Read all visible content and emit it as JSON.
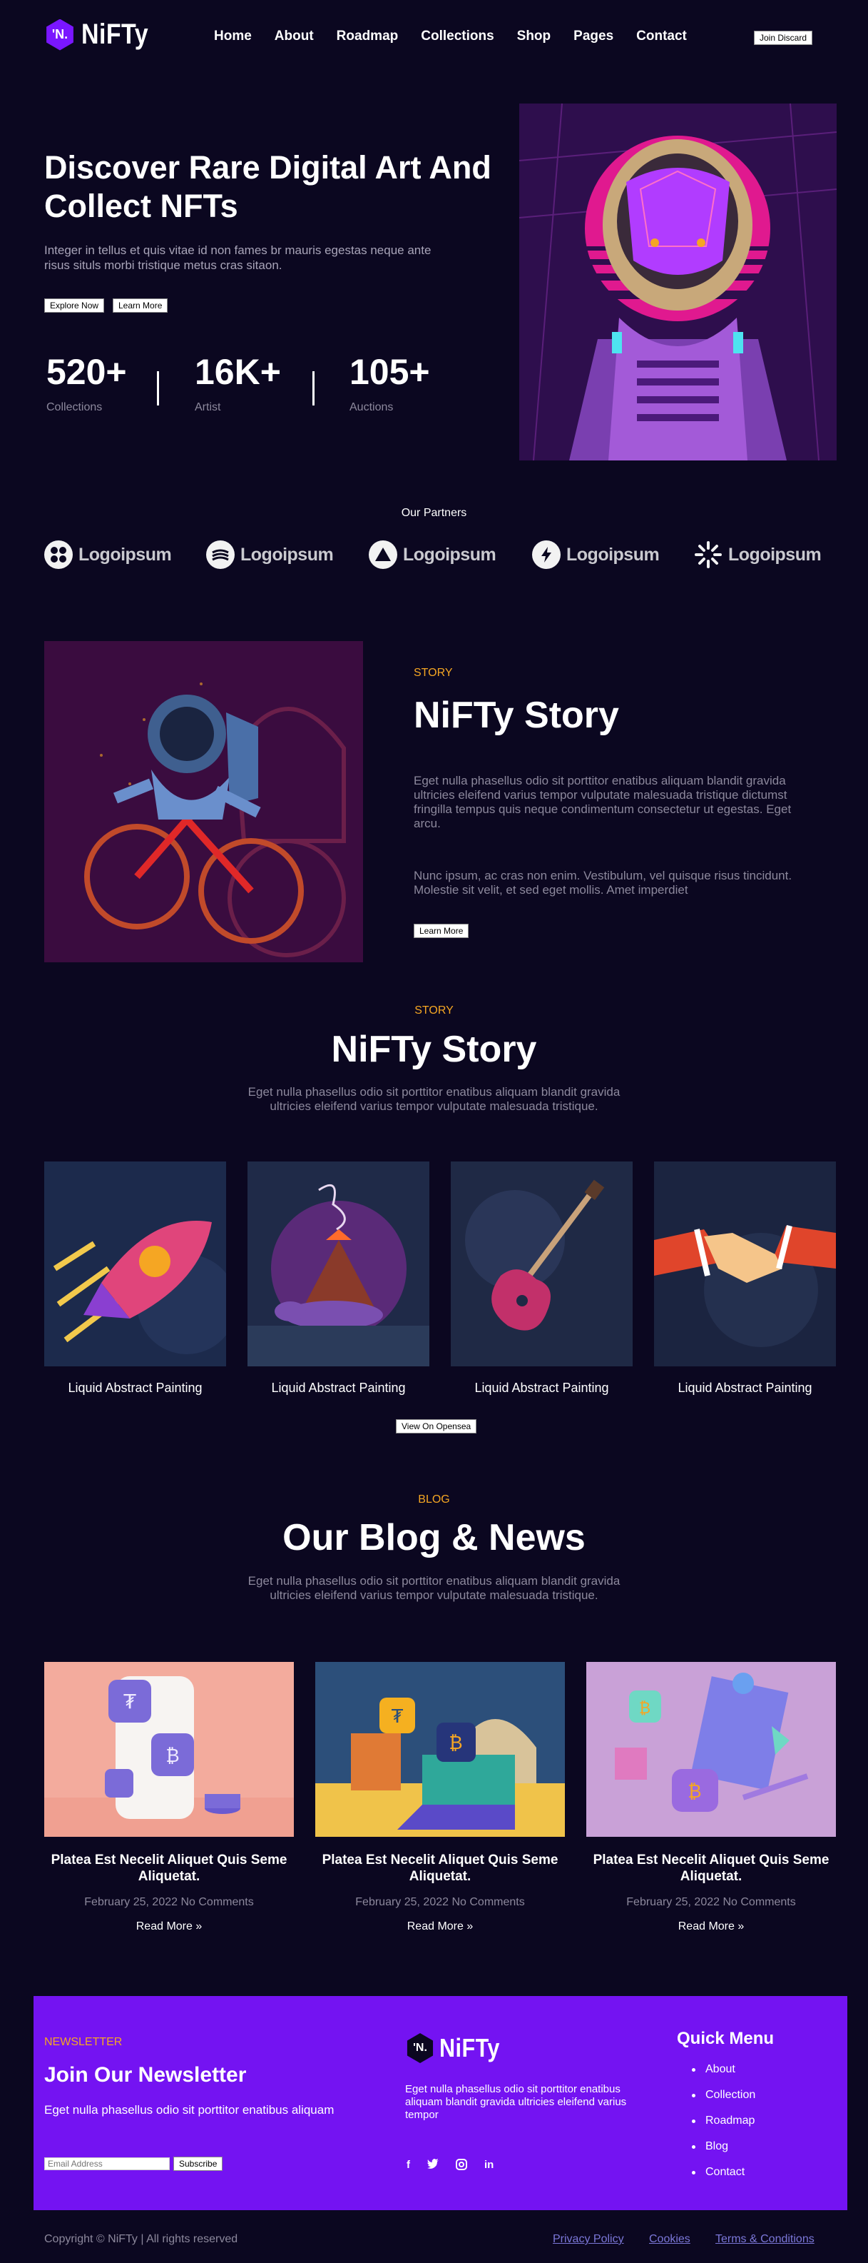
{
  "header": {
    "logo_badge": "'N.",
    "logo_text": "NiFTy",
    "nav": [
      "Home",
      "About",
      "Roadmap",
      "Collections",
      "Shop",
      "Pages",
      "Contact"
    ],
    "cta": "Join Discard"
  },
  "hero": {
    "title": "Discover Rare Digital Art And Collect NFTs",
    "subtitle": "Integer in tellus et quis vitae id non fames br mauris egestas neque ante risus situls morbi tristique metus cras sitaon.",
    "btn_explore": "Explore Now",
    "btn_learn": "Learn More",
    "stats": [
      {
        "value": "520+",
        "label": "Collections"
      },
      {
        "value": "16K+",
        "label": "Artist"
      },
      {
        "value": "105+",
        "label": "Auctions"
      }
    ]
  },
  "partners": {
    "title": "Our Partners",
    "items": [
      {
        "name": "Logoipsum",
        "icon": "grid-circles-icon"
      },
      {
        "name": "Logoipsum",
        "icon": "waves-circle-icon"
      },
      {
        "name": "Logoipsum",
        "icon": "triangle-circle-icon"
      },
      {
        "name": "Logoipsum",
        "icon": "bolt-circle-icon"
      },
      {
        "name": "Logoipsum",
        "icon": "sunburst-icon"
      }
    ]
  },
  "story": {
    "eyebrow": "STORY",
    "title": "NiFTy Story",
    "p1": "Eget nulla phasellus odio sit porttitor enatibus aliquam blandit gravida ultricies eleifend varius tempor vulputate malesuada tristique dictumst fringilla tempus quis neque condimentum consectetur ut egestas. Eget arcu.",
    "p2": "Nunc ipsum, ac cras non enim. Vestibulum, vel quisque risus tincidunt. Molestie sit velit, et sed eget mollis. Amet imperdiet",
    "btn": "Learn More"
  },
  "collection": {
    "eyebrow": "STORY",
    "title": "NiFTy Story",
    "text": "Eget nulla phasellus odio sit porttitor enatibus aliquam blandit gravida ultricies eleifend varius tempor vulputate malesuada tristique.",
    "items": [
      {
        "label": "Liquid Abstract Painting",
        "image": "rocket"
      },
      {
        "label": "Liquid Abstract Painting",
        "image": "volcano-dinosaur"
      },
      {
        "label": "Liquid Abstract Painting",
        "image": "guitar"
      },
      {
        "label": "Liquid Abstract Painting",
        "image": "handshake"
      }
    ],
    "btn": "View On Opensea"
  },
  "blog": {
    "eyebrow": "BLOG",
    "title": "Our Blog & News",
    "text": "Eget nulla phasellus odio sit porttitor enatibus aliquam blandit gravida ultricies eleifend varius tempor vulputate malesuada tristique.",
    "posts": [
      {
        "title": "Platea Est Necelit Aliquet Quis Seme Aliquetat.",
        "date": "February 25, 2022",
        "comments": "No Comments",
        "more": "Read More »"
      },
      {
        "title": "Platea Est Necelit Aliquet Quis Seme Aliquetat.",
        "date": "February 25, 2022",
        "comments": "No Comments",
        "more": "Read More »"
      },
      {
        "title": "Platea Est Necelit Aliquet Quis Seme Aliquetat.",
        "date": "February 25, 2022",
        "comments": "No Comments",
        "more": "Read More »"
      }
    ]
  },
  "newsletter": {
    "eyebrow": "NEWSLETTER",
    "title": "Join Our Newsletter",
    "text": "Eget nulla phasellus odio sit porttitor enatibus aliquam",
    "placeholder": "Email Address",
    "btn": "Subscribe",
    "brand_badge": "'N.",
    "brand_text": "NiFTy",
    "brand_desc": "Eget nulla phasellus odio sit porttitor enatibus aliquam blandit gravida ultricies eleifend varius tempor",
    "social": [
      "f",
      "t",
      "ig",
      "in"
    ],
    "menu_title": "Quick Menu",
    "menu": [
      "About",
      "Collection",
      "Roadmap",
      "Blog",
      "Contact"
    ]
  },
  "footer": {
    "copyright": "Copyright © NiFTy | All rights reserved",
    "links": [
      "Privacy Policy",
      "Cookies",
      "Terms & Conditions"
    ]
  },
  "colors": {
    "background": "#0b0720",
    "accent": "#7413f2",
    "eyebrow": "#f5a623",
    "muted": "#8c889c"
  }
}
